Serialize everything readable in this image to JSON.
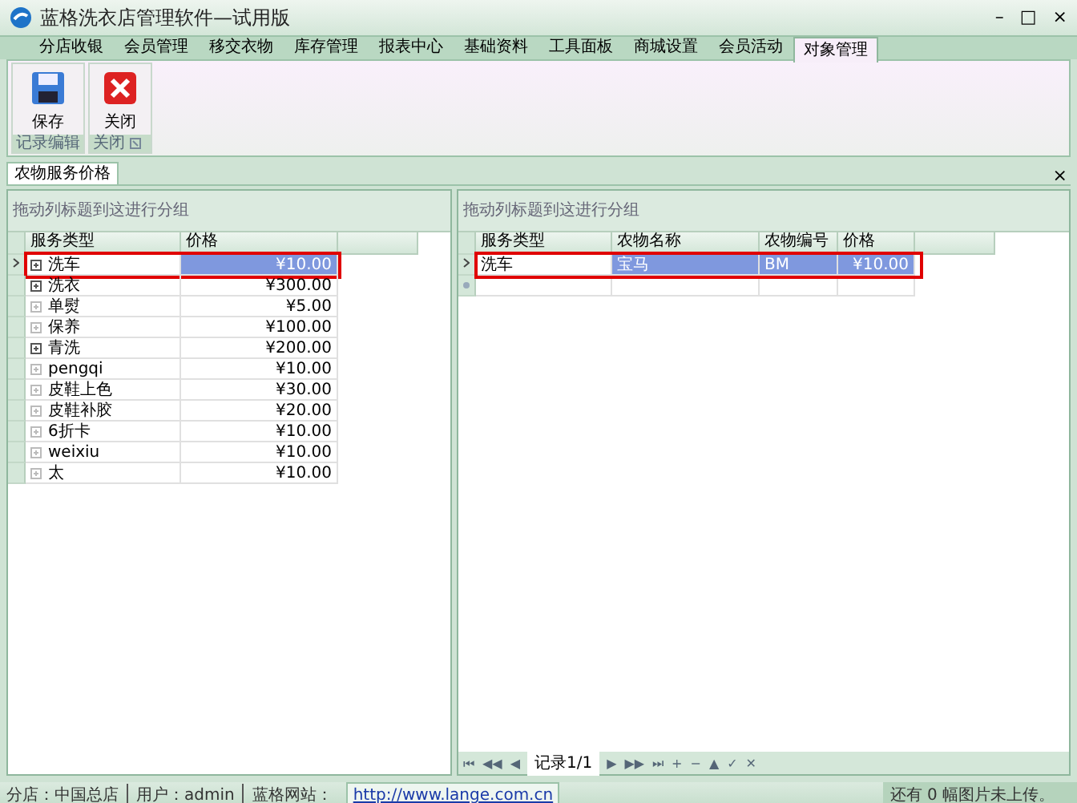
{
  "window": {
    "title": "蓝格洗衣店管理软件—试用版",
    "controls": [
      "–",
      "□",
      "×"
    ]
  },
  "ribbon_tabs": [
    {
      "label": "分店收银",
      "selected": false
    },
    {
      "label": "会员管理",
      "selected": false
    },
    {
      "label": "移交衣物",
      "selected": false
    },
    {
      "label": "库存管理",
      "selected": false
    },
    {
      "label": "报表中心",
      "selected": false
    },
    {
      "label": "基础资料",
      "selected": false
    },
    {
      "label": "工具面板",
      "selected": false
    },
    {
      "label": "商城设置",
      "selected": false
    },
    {
      "label": "会员活动",
      "selected": false
    },
    {
      "label": "对象管理",
      "selected": true
    }
  ],
  "ribbon_groups": [
    {
      "label": "记录编辑",
      "launcher": false,
      "buttons": [
        {
          "label": "保存",
          "kind": "save"
        }
      ]
    },
    {
      "label": "关闭",
      "launcher": true,
      "buttons": [
        {
          "label": "关闭",
          "kind": "close"
        }
      ]
    }
  ],
  "document_tab": {
    "label": "农物服务价格",
    "close": "×"
  },
  "left_grid": {
    "group_hint": "拖动列标题到这进行分组",
    "columns": [
      "服务类型",
      "价格"
    ],
    "rows": [
      {
        "type": "洗车",
        "price": "¥10.00",
        "expandable": true,
        "selected": true
      },
      {
        "type": "洗衣",
        "price": "¥300.00",
        "expandable": true,
        "selected": false
      },
      {
        "type": "单熨",
        "price": "¥5.00",
        "expandable": false,
        "selected": false
      },
      {
        "type": "保养",
        "price": "¥100.00",
        "expandable": false,
        "selected": false
      },
      {
        "type": "青洗",
        "price": "¥200.00",
        "expandable": true,
        "selected": false
      },
      {
        "type": "pengqi",
        "price": "¥10.00",
        "expandable": false,
        "selected": false
      },
      {
        "type": "皮鞋上色",
        "price": "¥30.00",
        "expandable": false,
        "selected": false
      },
      {
        "type": "皮鞋补胶",
        "price": "¥20.00",
        "expandable": false,
        "selected": false
      },
      {
        "type": "6折卡",
        "price": "¥10.00",
        "expandable": false,
        "selected": false
      },
      {
        "type": "weixiu",
        "price": "¥10.00",
        "expandable": false,
        "selected": false
      },
      {
        "type": "太",
        "price": "¥10.00",
        "expandable": false,
        "selected": false
      }
    ]
  },
  "right_grid": {
    "group_hint": "拖动列标题到这进行分组",
    "columns": [
      "服务类型",
      "农物名称",
      "农物编号",
      "价格"
    ],
    "rows": [
      {
        "cells": [
          "洗车",
          "宝马",
          "BM",
          "¥10.00"
        ],
        "selected": true
      }
    ],
    "navigator": {
      "before": [
        "⏮",
        "◀◀",
        "◀"
      ],
      "record": "记录1/1",
      "after": [
        "▶",
        "▶▶",
        "⏭",
        "+",
        "−",
        "▲",
        "✓",
        "✕"
      ]
    }
  },
  "status_bar": {
    "branch": "分店：中国总店",
    "user": "用户：admin",
    "site_label": "蓝格网站：",
    "site_url": "http://www.lange.com.cn",
    "upload": "还有 0 幅图片未上传。"
  }
}
